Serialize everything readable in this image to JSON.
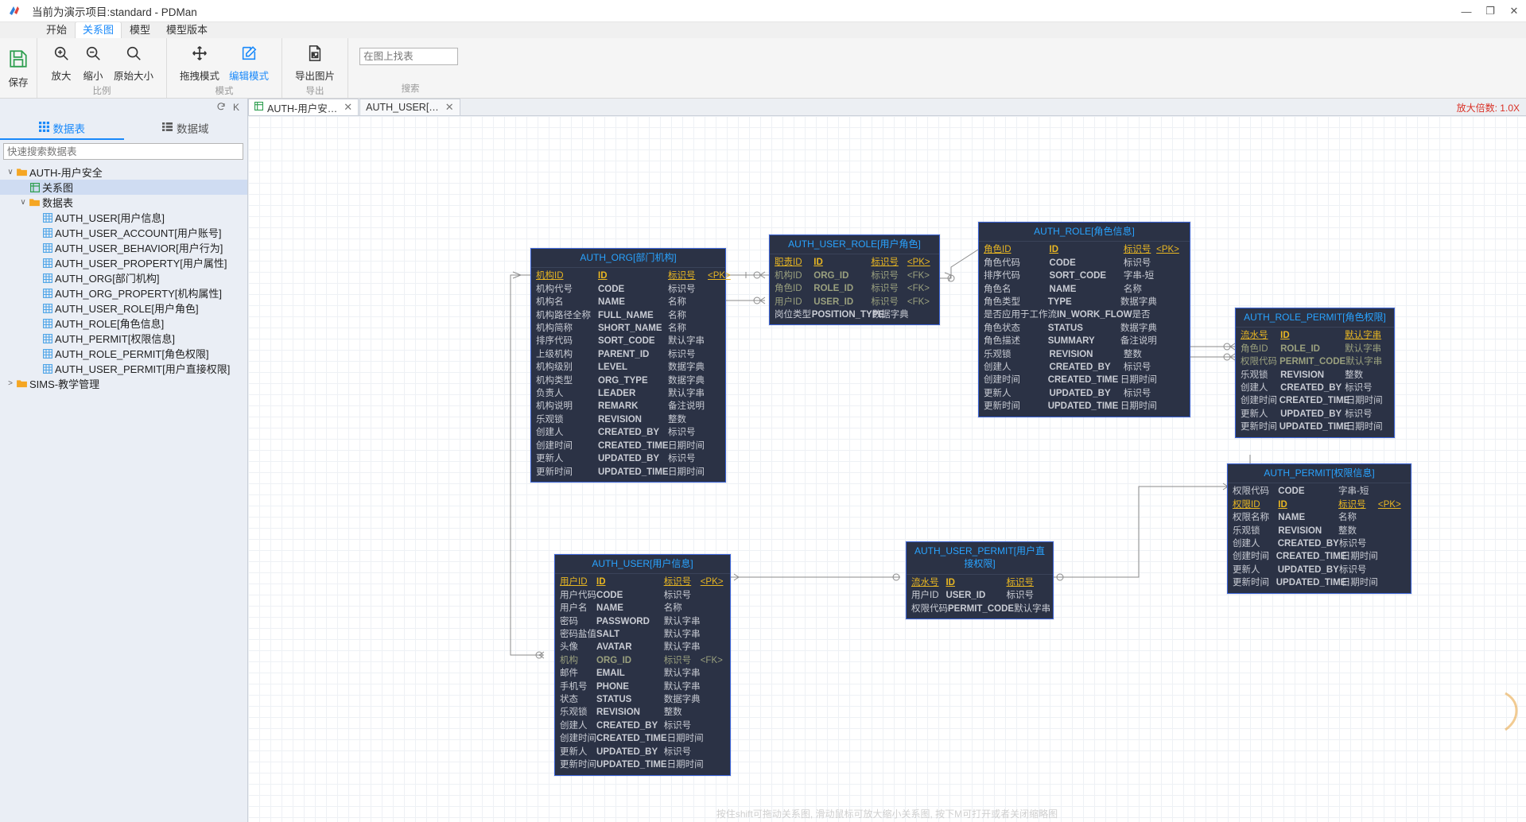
{
  "window": {
    "title": "当前为演示项目:standard - PDMan",
    "minimize": "—",
    "maximize": "❐",
    "close": "✕"
  },
  "menu": {
    "items": [
      "开始",
      "关系图",
      "模型",
      "模型版本"
    ],
    "active": "关系图"
  },
  "ribbon": {
    "save": {
      "label": "保存",
      "icon": "save-icon"
    },
    "groups": [
      {
        "title": "比例",
        "buttons": [
          {
            "label": "放大",
            "icon": "zoom-in-icon"
          },
          {
            "label": "缩小",
            "icon": "zoom-out-icon"
          },
          {
            "label": "原始大小",
            "icon": "zoom-reset-icon"
          }
        ]
      },
      {
        "title": "模式",
        "buttons": [
          {
            "label": "拖拽模式",
            "icon": "move-icon"
          },
          {
            "label": "编辑模式",
            "icon": "edit-icon",
            "accent": true
          }
        ]
      },
      {
        "title": "导出",
        "buttons": [
          {
            "label": "导出图片",
            "icon": "export-image-icon"
          }
        ]
      }
    ],
    "search": {
      "title": "搜索",
      "placeholder": "在图上找表",
      "value": ""
    }
  },
  "sidebar": {
    "refresh_icon": "refresh-icon",
    "collapse_label": "K",
    "tabs": [
      {
        "label": "数据表",
        "icon": "grid-icon",
        "active": true
      },
      {
        "label": "数据域",
        "icon": "list-icon",
        "active": false
      }
    ],
    "search_placeholder": "快速搜索数据表",
    "tree": [
      {
        "level": 1,
        "caret": "∨",
        "icon": "folder-icon",
        "label": "AUTH-用户安全",
        "selected": false
      },
      {
        "level": 2,
        "caret": "",
        "icon": "diagram-icon",
        "label": "关系图",
        "selected": true
      },
      {
        "level": 2,
        "caret": "∨",
        "icon": "folder-icon",
        "label": "数据表",
        "selected": false
      },
      {
        "level": 3,
        "caret": "",
        "icon": "table-icon",
        "label": "AUTH_USER[用户信息]",
        "selected": false
      },
      {
        "level": 3,
        "caret": "",
        "icon": "table-icon",
        "label": "AUTH_USER_ACCOUNT[用户账号]",
        "selected": false
      },
      {
        "level": 3,
        "caret": "",
        "icon": "table-icon",
        "label": "AUTH_USER_BEHAVIOR[用户行为]",
        "selected": false
      },
      {
        "level": 3,
        "caret": "",
        "icon": "table-icon",
        "label": "AUTH_USER_PROPERTY[用户属性]",
        "selected": false
      },
      {
        "level": 3,
        "caret": "",
        "icon": "table-icon",
        "label": "AUTH_ORG[部门机构]",
        "selected": false
      },
      {
        "level": 3,
        "caret": "",
        "icon": "table-icon",
        "label": "AUTH_ORG_PROPERTY[机构属性]",
        "selected": false
      },
      {
        "level": 3,
        "caret": "",
        "icon": "table-icon",
        "label": "AUTH_USER_ROLE[用户角色]",
        "selected": false
      },
      {
        "level": 3,
        "caret": "",
        "icon": "table-icon",
        "label": "AUTH_ROLE[角色信息]",
        "selected": false
      },
      {
        "level": 3,
        "caret": "",
        "icon": "table-icon",
        "label": "AUTH_PERMIT[权限信息]",
        "selected": false
      },
      {
        "level": 3,
        "caret": "",
        "icon": "table-icon",
        "label": "AUTH_ROLE_PERMIT[角色权限]",
        "selected": false
      },
      {
        "level": 3,
        "caret": "",
        "icon": "table-icon",
        "label": "AUTH_USER_PERMIT[用户直接权限]",
        "selected": false
      },
      {
        "level": 1,
        "caret": ">",
        "icon": "folder-icon",
        "label": "SIMS-教学管理",
        "selected": false
      }
    ]
  },
  "canvas": {
    "tabs": [
      {
        "label": "AUTH-用户安…",
        "icon": "diagram-icon",
        "active": true,
        "close": "✕"
      },
      {
        "label": "AUTH_USER[…",
        "icon": "",
        "active": false,
        "close": "✕"
      }
    ],
    "zoom_label": "放大倍数: 1.0X",
    "hint": "按住shift可拖动关系图, 滑动鼠标可放大缩小关系图, 按下M可打开或者关闭缩略图"
  },
  "tables": [
    {
      "key": "t-org",
      "title": "AUTH_ORG[部门机构]",
      "rows": [
        {
          "name": "机构ID",
          "field": "ID",
          "type": "标识号",
          "key": "<PK>",
          "kind": "pk"
        },
        {
          "name": "机构代号",
          "field": "CODE",
          "type": "标识号",
          "key": "",
          "kind": ""
        },
        {
          "name": "机构名",
          "field": "NAME",
          "type": "名称",
          "key": "",
          "kind": ""
        },
        {
          "name": "机构路径全称",
          "field": "FULL_NAME",
          "type": "名称",
          "key": "",
          "kind": ""
        },
        {
          "name": "机构简称",
          "field": "SHORT_NAME",
          "type": "名称",
          "key": "",
          "kind": ""
        },
        {
          "name": "排序代码",
          "field": "SORT_CODE",
          "type": "默认字串",
          "key": "",
          "kind": ""
        },
        {
          "name": "上级机构",
          "field": "PARENT_ID",
          "type": "标识号",
          "key": "",
          "kind": ""
        },
        {
          "name": "机构级别",
          "field": "LEVEL",
          "type": "数据字典",
          "key": "",
          "kind": ""
        },
        {
          "name": "机构类型",
          "field": "ORG_TYPE",
          "type": "数据字典",
          "key": "",
          "kind": ""
        },
        {
          "name": "负责人",
          "field": "LEADER",
          "type": "默认字串",
          "key": "",
          "kind": ""
        },
        {
          "name": "机构说明",
          "field": "REMARK",
          "type": "备注说明",
          "key": "",
          "kind": ""
        },
        {
          "name": "乐观锁",
          "field": "REVISION",
          "type": "整数",
          "key": "",
          "kind": ""
        },
        {
          "name": "创建人",
          "field": "CREATED_BY",
          "type": "标识号",
          "key": "",
          "kind": ""
        },
        {
          "name": "创建时间",
          "field": "CREATED_TIME",
          "type": "日期时间",
          "key": "",
          "kind": ""
        },
        {
          "name": "更新人",
          "field": "UPDATED_BY",
          "type": "标识号",
          "key": "",
          "kind": ""
        },
        {
          "name": "更新时间",
          "field": "UPDATED_TIME",
          "type": "日期时间",
          "key": "",
          "kind": ""
        }
      ]
    },
    {
      "key": "t-ur",
      "title": "AUTH_USER_ROLE[用户角色]",
      "rows": [
        {
          "name": "职责ID",
          "field": "ID",
          "type": "标识号",
          "key": "<PK>",
          "kind": "pk"
        },
        {
          "name": "机构ID",
          "field": "ORG_ID",
          "type": "标识号",
          "key": "<FK>",
          "kind": "fk"
        },
        {
          "name": "角色ID",
          "field": "ROLE_ID",
          "type": "标识号",
          "key": "<FK>",
          "kind": "fk"
        },
        {
          "name": "用户ID",
          "field": "USER_ID",
          "type": "标识号",
          "key": "<FK>",
          "kind": "fk"
        },
        {
          "name": "岗位类型",
          "field": "POSITION_TYPE",
          "type": "数据字典",
          "key": "",
          "kind": ""
        }
      ]
    },
    {
      "key": "t-role",
      "title": "AUTH_ROLE[角色信息]",
      "rows": [
        {
          "name": "角色ID",
          "field": "ID",
          "type": "标识号",
          "key": "<PK>",
          "kind": "pk"
        },
        {
          "name": "角色代码",
          "field": "CODE",
          "type": "标识号",
          "key": "",
          "kind": ""
        },
        {
          "name": "排序代码",
          "field": "SORT_CODE",
          "type": "字串-短",
          "key": "",
          "kind": ""
        },
        {
          "name": "角色名",
          "field": "NAME",
          "type": "名称",
          "key": "",
          "kind": ""
        },
        {
          "name": "角色类型",
          "field": "TYPE",
          "type": "数据字典",
          "key": "",
          "kind": ""
        },
        {
          "name": "是否应用于工作流",
          "field": "IN_WORK_FLOW",
          "type": "是否",
          "key": "",
          "kind": ""
        },
        {
          "name": "角色状态",
          "field": "STATUS",
          "type": "数据字典",
          "key": "",
          "kind": ""
        },
        {
          "name": "角色描述",
          "field": "SUMMARY",
          "type": "备注说明",
          "key": "",
          "kind": ""
        },
        {
          "name": "乐观锁",
          "field": "REVISION",
          "type": "整数",
          "key": "",
          "kind": ""
        },
        {
          "name": "创建人",
          "field": "CREATED_BY",
          "type": "标识号",
          "key": "",
          "kind": ""
        },
        {
          "name": "创建时间",
          "field": "CREATED_TIME",
          "type": "日期时间",
          "key": "",
          "kind": ""
        },
        {
          "name": "更新人",
          "field": "UPDATED_BY",
          "type": "标识号",
          "key": "",
          "kind": ""
        },
        {
          "name": "更新时间",
          "field": "UPDATED_TIME",
          "type": "日期时间",
          "key": "",
          "kind": ""
        }
      ]
    },
    {
      "key": "t-rp",
      "title": "AUTH_ROLE_PERMIT[角色权限]",
      "rows": [
        {
          "name": "流水号",
          "field": "ID",
          "type": "默认字串",
          "key": "",
          "kind": "pk"
        },
        {
          "name": "角色ID",
          "field": "ROLE_ID",
          "type": "默认字串",
          "key": "",
          "kind": "fk"
        },
        {
          "name": "权限代码",
          "field": "PERMIT_CODE",
          "type": "默认字串",
          "key": "",
          "kind": "fk"
        },
        {
          "name": "乐观锁",
          "field": "REVISION",
          "type": "整数",
          "key": "",
          "kind": ""
        },
        {
          "name": "创建人",
          "field": "CREATED_BY",
          "type": "标识号",
          "key": "",
          "kind": ""
        },
        {
          "name": "创建时间",
          "field": "CREATED_TIME",
          "type": "日期时间",
          "key": "",
          "kind": ""
        },
        {
          "name": "更新人",
          "field": "UPDATED_BY",
          "type": "标识号",
          "key": "",
          "kind": ""
        },
        {
          "name": "更新时间",
          "field": "UPDATED_TIME",
          "type": "日期时间",
          "key": "",
          "kind": ""
        }
      ]
    },
    {
      "key": "t-perm",
      "title": "AUTH_PERMIT[权限信息]",
      "rows": [
        {
          "name": "权限代码",
          "field": "CODE",
          "type": "字串-短",
          "key": "",
          "kind": ""
        },
        {
          "name": "权限ID",
          "field": "ID",
          "type": "标识号",
          "key": "<PK>",
          "kind": "pk"
        },
        {
          "name": "权限名称",
          "field": "NAME",
          "type": "名称",
          "key": "",
          "kind": ""
        },
        {
          "name": "乐观锁",
          "field": "REVISION",
          "type": "整数",
          "key": "",
          "kind": ""
        },
        {
          "name": "创建人",
          "field": "CREATED_BY",
          "type": "标识号",
          "key": "",
          "kind": ""
        },
        {
          "name": "创建时间",
          "field": "CREATED_TIME",
          "type": "日期时间",
          "key": "",
          "kind": ""
        },
        {
          "name": "更新人",
          "field": "UPDATED_BY",
          "type": "标识号",
          "key": "",
          "kind": ""
        },
        {
          "name": "更新时间",
          "field": "UPDATED_TIME",
          "type": "日期时间",
          "key": "",
          "kind": ""
        }
      ]
    },
    {
      "key": "t-up",
      "title": "AUTH_USER_PERMIT[用户直接权限]",
      "rows": [
        {
          "name": "流水号",
          "field": "ID",
          "type": "标识号",
          "key": "",
          "kind": "pk"
        },
        {
          "name": "用户ID",
          "field": "USER_ID",
          "type": "标识号",
          "key": "",
          "kind": ""
        },
        {
          "name": "权限代码",
          "field": "PERMIT_CODE",
          "type": "默认字串",
          "key": "",
          "kind": ""
        }
      ]
    },
    {
      "key": "t-user",
      "title": "AUTH_USER[用户信息]",
      "rows": [
        {
          "name": "用户ID",
          "field": "ID",
          "type": "标识号",
          "key": "<PK>",
          "kind": "pk"
        },
        {
          "name": "用户代码",
          "field": "CODE",
          "type": "标识号",
          "key": "",
          "kind": ""
        },
        {
          "name": "用户名",
          "field": "NAME",
          "type": "名称",
          "key": "",
          "kind": ""
        },
        {
          "name": "密码",
          "field": "PASSWORD",
          "type": "默认字串",
          "key": "",
          "kind": ""
        },
        {
          "name": "密码盐值",
          "field": "SALT",
          "type": "默认字串",
          "key": "",
          "kind": ""
        },
        {
          "name": "头像",
          "field": "AVATAR",
          "type": "默认字串",
          "key": "",
          "kind": ""
        },
        {
          "name": "机构",
          "field": "ORG_ID",
          "type": "标识号",
          "key": "<FK>",
          "kind": "fk"
        },
        {
          "name": "邮件",
          "field": "EMAIL",
          "type": "默认字串",
          "key": "",
          "kind": ""
        },
        {
          "name": "手机号",
          "field": "PHONE",
          "type": "默认字串",
          "key": "",
          "kind": ""
        },
        {
          "name": "状态",
          "field": "STATUS",
          "type": "数据字典",
          "key": "",
          "kind": ""
        },
        {
          "name": "乐观锁",
          "field": "REVISION",
          "type": "整数",
          "key": "",
          "kind": ""
        },
        {
          "name": "创建人",
          "field": "CREATED_BY",
          "type": "标识号",
          "key": "",
          "kind": ""
        },
        {
          "name": "创建时间",
          "field": "CREATED_TIME",
          "type": "日期时间",
          "key": "",
          "kind": ""
        },
        {
          "name": "更新人",
          "field": "UPDATED_BY",
          "type": "标识号",
          "key": "",
          "kind": ""
        },
        {
          "name": "更新时间",
          "field": "UPDATED_TIME",
          "type": "日期时间",
          "key": "",
          "kind": ""
        }
      ]
    }
  ],
  "colors": {
    "accent": "#1989fa",
    "table_bg": "#2b3245",
    "table_border": "#3a63d8",
    "table_title": "#29a3ff",
    "pk_gold": "#e8b622",
    "fk_olive": "#9aa07e",
    "zoom_red": "#d93025"
  }
}
